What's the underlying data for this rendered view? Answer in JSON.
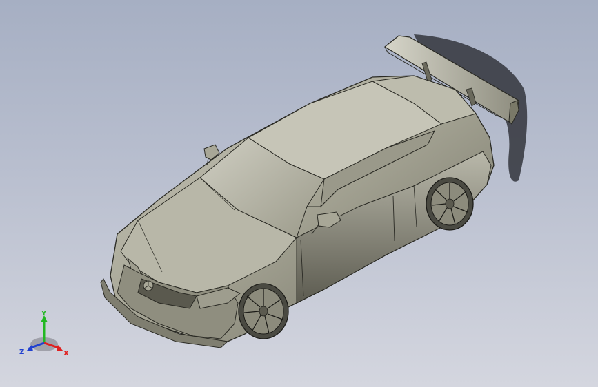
{
  "viewport": {
    "background_top": "#a6afc3",
    "background_bottom": "#d4d6df",
    "model": "sports-car-coupe-with-rear-wing",
    "body_color": "#a3a293",
    "edge_color": "#2a2a24"
  },
  "triad": {
    "x_label": "X",
    "y_label": "Y",
    "z_label": "Z",
    "x_color": "#e02020",
    "y_color": "#22b822",
    "z_color": "#2040d0"
  }
}
